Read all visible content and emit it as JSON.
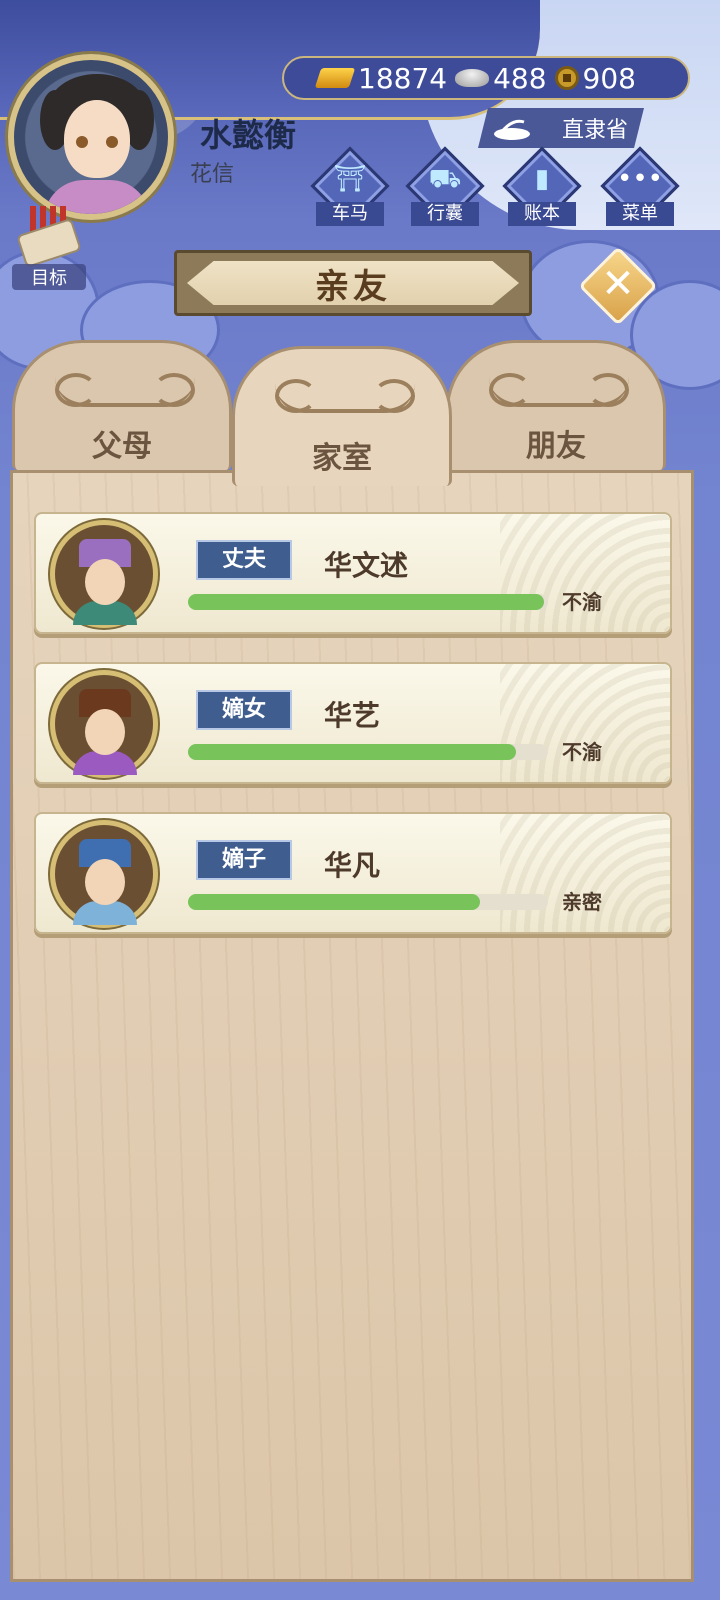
{
  "player": {
    "name": "水懿衡",
    "subtitle": "花信"
  },
  "currency": {
    "gold": "18874",
    "silver": "488",
    "coins": "908"
  },
  "location": "直隶省",
  "menu": [
    {
      "label": "车马",
      "icon": "carriage-icon"
    },
    {
      "label": "行囊",
      "icon": "bag-icon"
    },
    {
      "label": "账本",
      "icon": "ledger-icon"
    },
    {
      "label": "菜单",
      "icon": "more-icon"
    }
  ],
  "goal_label": "目标",
  "title": "亲友",
  "tabs": [
    {
      "label": "父母",
      "active": false
    },
    {
      "label": "家室",
      "active": true
    },
    {
      "label": "朋友",
      "active": false
    }
  ],
  "members": [
    {
      "relation": "丈夫",
      "name": "华文述",
      "affection": 0.99,
      "status": "不渝",
      "hat_color": "#9a6fc0",
      "robe_color": "#3d8a78"
    },
    {
      "relation": "嫡女",
      "name": "华艺",
      "affection": 0.91,
      "status": "不渝",
      "hat_color": "#6b3a1e",
      "robe_color": "#9a5ac0"
    },
    {
      "relation": "嫡子",
      "name": "华凡",
      "affection": 0.81,
      "status": "亲密",
      "hat_color": "#3f6fb0",
      "robe_color": "#7fb2d8"
    }
  ],
  "colors": {
    "background": "#6e7fcf",
    "panel": "#e0ccb0",
    "progress": "#78c45a",
    "relation_badge": "#3f5d8e"
  }
}
